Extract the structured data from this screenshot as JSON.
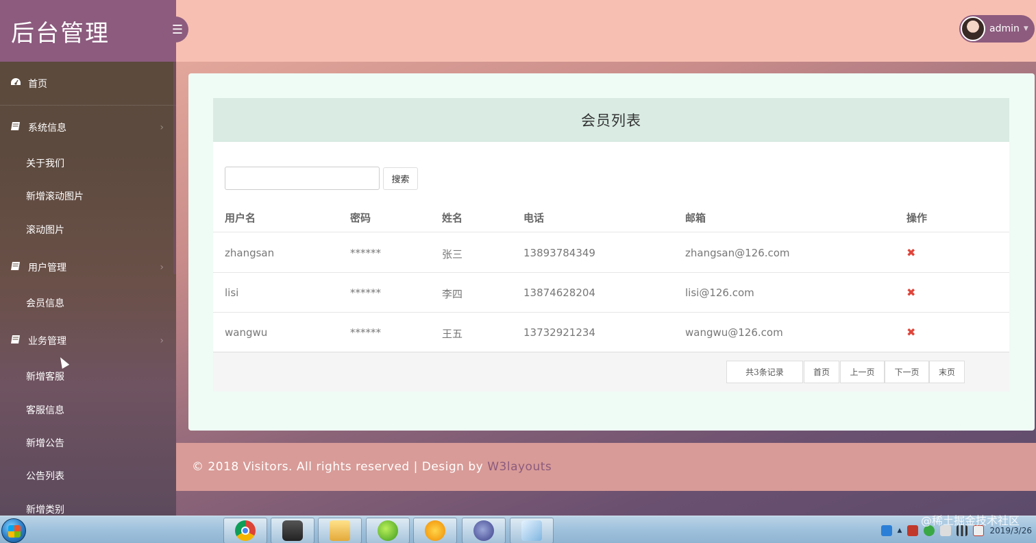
{
  "brand": {
    "title": "后台管理"
  },
  "topbar": {
    "user_name": "admin"
  },
  "sidebar": {
    "items": [
      {
        "label": "首页",
        "icon": "dashboard-icon"
      },
      {
        "label": "系统信息",
        "icon": "book-icon",
        "children": [
          "关于我们",
          "新增滚动图片",
          "滚动图片"
        ]
      },
      {
        "label": "用户管理",
        "icon": "book-icon",
        "children": [
          "会员信息"
        ]
      },
      {
        "label": "业务管理",
        "icon": "book-icon",
        "children": [
          "新增客服",
          "客服信息",
          "新增公告",
          "公告列表",
          "新增类别"
        ]
      }
    ]
  },
  "main": {
    "panel_title": "会员列表",
    "search": {
      "placeholder": "",
      "value": "",
      "button_label": "搜索"
    },
    "table": {
      "headers": [
        "用户名",
        "密码",
        "姓名",
        "电话",
        "邮箱",
        "操作"
      ],
      "rows": [
        {
          "username": "zhangsan",
          "password": "******",
          "name": "张三",
          "phone": "13893784349",
          "email": "zhangsan@126.com"
        },
        {
          "username": "lisi",
          "password": "******",
          "name": "李四",
          "phone": "13874628204",
          "email": "lisi@126.com"
        },
        {
          "username": "wangwu",
          "password": "******",
          "name": "王五",
          "phone": "13732921234",
          "email": "wangwu@126.com"
        }
      ]
    },
    "pagination": {
      "total": "共3条记录",
      "first": "首页",
      "prev": "上一页",
      "next": "下一页",
      "last": "末页"
    }
  },
  "footer": {
    "text": "© 2018 Visitors. All rights reserved | Design by",
    "link": "W3layouts"
  },
  "taskbar": {
    "apps": [
      "chrome-icon",
      "agent-icon",
      "explorer-icon",
      "app-green-icon",
      "media-player-icon",
      "eclipse-icon",
      "notepad-icon"
    ],
    "clock_time": "",
    "clock_date": "2019/3/26"
  },
  "watermark": "@稀土掘金技术社区",
  "colors": {
    "brand": "#8c5b7e",
    "topbar": "#f7bfb1",
    "panel_head": "#d9ebe3",
    "delete": "#e0453a"
  }
}
